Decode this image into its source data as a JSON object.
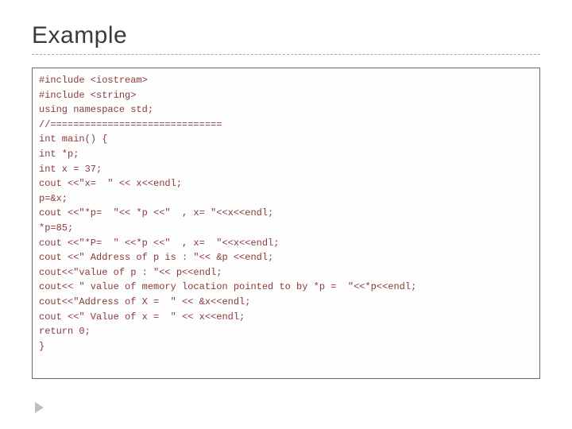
{
  "title": "Example",
  "code": {
    "lines": [
      "#include <iostream>",
      "#include <string>",
      "using namespace std;",
      "//==============================",
      "int main() {",
      "int *p;",
      "int x = 37;",
      "cout <<\"x=  \" << x<<endl;",
      "p=&x;",
      "cout <<\"*p=  \"<< *p <<\"  , x= \"<<x<<endl;",
      "*p=85;",
      "cout <<\"*P=  \" <<*p <<\"  , x=  \"<<x<<endl;",
      "cout <<\" Address of p is : \"<< &p <<endl;",
      "cout<<\"value of p : \"<< p<<endl;",
      "cout<< \" value of memory location pointed to by *p =  \"<<*p<<endl;",
      "cout<<\"Address of X =  \" << &x<<endl;",
      "cout <<\" Value of x =  \" << x<<endl;",
      "return 0;",
      "}"
    ]
  }
}
